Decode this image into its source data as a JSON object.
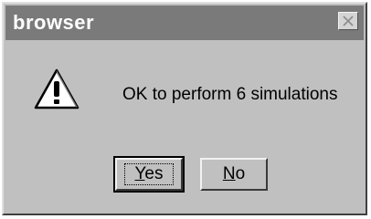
{
  "window": {
    "title": "browser",
    "close_icon": "close-x-icon"
  },
  "message": {
    "icon": "warning-exclamation-icon",
    "text": "OK to perform 6 simulations"
  },
  "buttons": {
    "yes": {
      "mnemonic": "Y",
      "rest": "es"
    },
    "no": {
      "mnemonic": "N",
      "rest": "o"
    }
  },
  "colors": {
    "titlebar": "#7a7a7a",
    "dialog_bg": "#c0c0c0",
    "icon_fill": "#ffffff",
    "icon_stroke": "#000000"
  }
}
